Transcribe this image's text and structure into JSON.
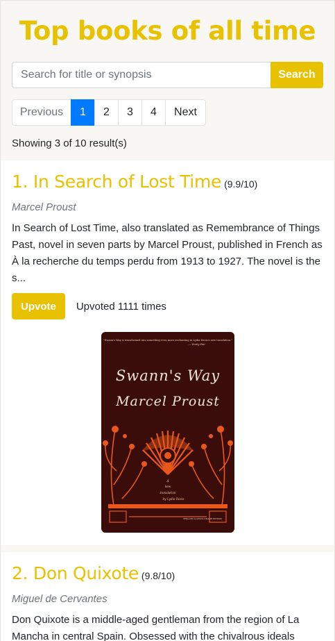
{
  "header": {
    "title": "Top books of all time"
  },
  "search": {
    "placeholder": "Search for title or synopsis",
    "value": "",
    "button_label": "Search"
  },
  "pagination": {
    "previous_label": "Previous",
    "pages": [
      "1",
      "2",
      "3",
      "4"
    ],
    "active_page": "1",
    "next_label": "Next"
  },
  "results": {
    "count_text": "Showing 3 of 10 result(s)"
  },
  "books": [
    {
      "title": "1. In Search of Lost Time",
      "rating": "(9.9/10)",
      "author": "Marcel Proust",
      "synopsis": "In Search of Lost Time, also translated as Remembrance of Things Past, novel in seven parts by Marcel Proust, published in French as À la recherche du temps perdu from 1913 to 1927. The novel is the s...",
      "upvote_label": "Upvote",
      "upvote_text": "Upvoted 1111 times",
      "cover": {
        "blurb": "\"Swann's Way is transformed into something even more enchanting in Lydia Davis's new translation.\"",
        "blurb_source": "— Vanity Fair",
        "title": "Swann's Way",
        "author": "Marcel Proust",
        "subtitle_line1": "A",
        "subtitle_line2": "new",
        "subtitle_line3": "translation",
        "subtitle_line4": "by Lydia Davis",
        "publisher": "PENGUIN CLASSICS  DELUXE EDITION"
      }
    },
    {
      "title": "2. Don Quixote",
      "rating": "(9.8/10)",
      "author": "Miguel de Cervantes",
      "synopsis": "Don Quixote is a middle-aged gentleman from the region of La Mancha in central Spain. Obsessed with the chivalrous ideals"
    }
  ],
  "colors": {
    "accent": "#e8c100",
    "active_page": "#007bff",
    "cover_background": "#3a0c0a",
    "cover_ornament": "#e8581c"
  }
}
